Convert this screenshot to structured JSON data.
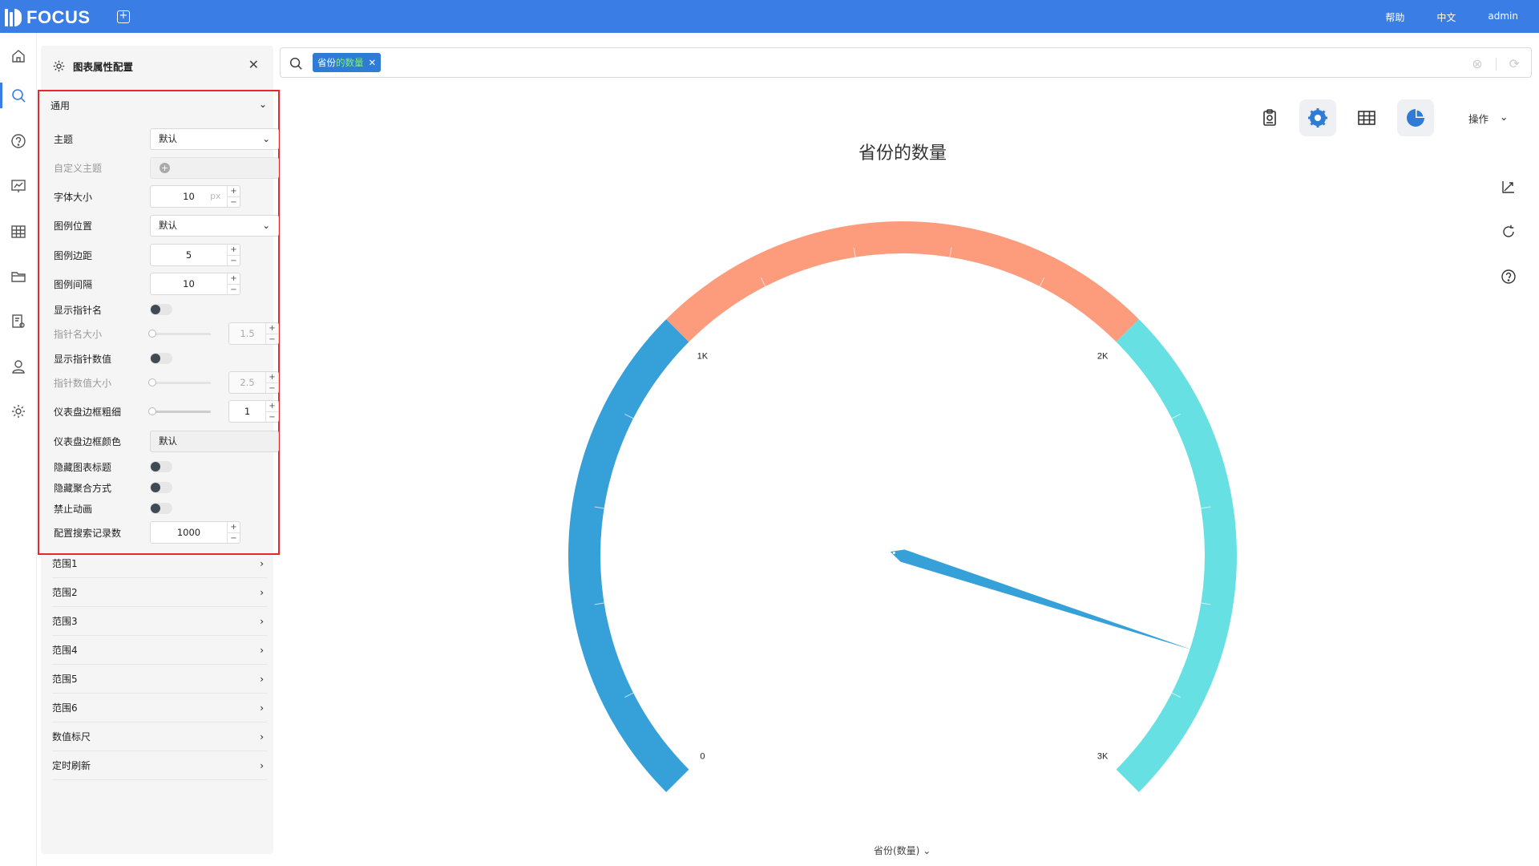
{
  "app": {
    "logo": "FOCUS",
    "links": [
      "帮助",
      "中文",
      "admin"
    ]
  },
  "panel": {
    "title": "图表属性配置",
    "general": {
      "title": "通用",
      "theme_label": "主题",
      "theme_value": "默认",
      "custom_theme_label": "自定义主题",
      "font_size_label": "字体大小",
      "font_size_value": "10",
      "font_size_unit": "px",
      "legend_pos_label": "图例位置",
      "legend_pos_value": "默认",
      "legend_margin_label": "图例边距",
      "legend_margin_value": "5",
      "legend_gap_label": "图例间隔",
      "legend_gap_value": "10",
      "show_pointer_name_label": "显示指针名",
      "pointer_name_size_label": "指针名大小",
      "pointer_name_size_value": "1.5",
      "show_pointer_value_label": "显示指针数值",
      "pointer_value_size_label": "指针数值大小",
      "pointer_value_size_value": "2.5",
      "border_width_label": "仪表盘边框粗细",
      "border_width_value": "1",
      "border_color_label": "仪表盘边框颜色",
      "border_color_value": "默认",
      "hide_title_label": "隐藏图表标题",
      "hide_agg_label": "隐藏聚合方式",
      "no_anim_label": "禁止动画",
      "search_count_label": "配置搜索记录数",
      "search_count_value": "1000"
    },
    "sections": [
      "范围1",
      "范围2",
      "范围3",
      "范围4",
      "范围5",
      "范围6",
      "数值标尺",
      "定时刷新"
    ]
  },
  "search": {
    "chip_part1": "省份",
    "chip_part2": "的数量"
  },
  "toolbar": {
    "ops_label": "操作"
  },
  "chart_data": {
    "type": "gauge",
    "title": "省份的数量",
    "min": 0,
    "max": 3000,
    "tick_labels": [
      "0",
      "1K",
      "2K",
      "3K"
    ],
    "bands": [
      {
        "from": 0,
        "to": 1000,
        "color": "#36a0d9"
      },
      {
        "from": 1000,
        "to": 2000,
        "color": "#fd9b7d"
      },
      {
        "from": 2000,
        "to": 3000,
        "color": "#67e0e3"
      }
    ],
    "pointer_value": 2700,
    "pointer_color": "#36a0d9",
    "axis_label": "省份(数量)"
  }
}
